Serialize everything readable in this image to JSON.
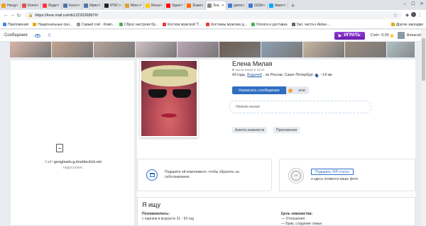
{
  "tabs": [
    {
      "label": "Неодн",
      "color": "#f0a020"
    },
    {
      "label": "Конче",
      "color": "#e05050"
    },
    {
      "label": "Яндекс",
      "color": "#ff3333"
    },
    {
      "label": "Конта",
      "color": "#4a76a8"
    },
    {
      "label": "Ирина",
      "color": "#4a76a8"
    },
    {
      "label": "IPSC ",
      "color": "#222222"
    },
    {
      "label": "Мои ст",
      "color": "#e0a030"
    },
    {
      "label": "Renault",
      "color": "#ffcc00"
    },
    {
      "label": "Удале",
      "color": "#ff0000"
    },
    {
      "label": "Знако",
      "color": "#ff6600"
    },
    {
      "label": "Зна",
      "color": "#888888",
      "active": true
    },
    {
      "label": "gismet",
      "color": "#3a7bd5"
    },
    {
      "label": "GISME",
      "color": "#3a7bd5"
    },
    {
      "label": "Авито",
      "color": "#00aaff"
    }
  ],
  "address": {
    "url": "https://love.mail.ru/mb1222026897#/"
  },
  "bookmarks": [
    {
      "label": "Приложения",
      "color": "#4285f4"
    },
    {
      "label": "Национальные син...",
      "color": "#e6a817"
    },
    {
      "label": "Самый сок! - Комп...",
      "color": "#999999"
    },
    {
      "label": "Сброс настроек бр...",
      "color": "#4caf50"
    },
    {
      "label": "Костюм мужской \"Г...",
      "color": "#e53935"
    },
    {
      "label": "Костюмы мужские д...",
      "color": "#e53935"
    },
    {
      "label": "Оплата и доставка",
      "color": "#4caf50"
    },
    {
      "label": "Зап. части к Akkar-...",
      "color": "#666666"
    }
  ],
  "bookmarks_other": "Другие закладки",
  "header": {
    "messages": "Сообщения",
    "play": "ИГРАТЬ",
    "score": "Счёт: 0.00",
    "user": "Алексей"
  },
  "photostrip_colors": [
    "#d9b5a8",
    "#c4a48f",
    "#b7a29a",
    "#d0c0c4",
    "#bca6b8",
    "#6f5e54",
    "#8ea0b2",
    "#c8b6a0",
    "#9b8c7d",
    "#b2c1c8"
  ],
  "profile": {
    "name": "Елена Милая",
    "online": "Была вчера в 19:31",
    "meta_age": "43 года,",
    "meta_zodiac": "Водолей",
    "meta_from": ", из России, Санкт-Петербург",
    "meta_dist": "~14 км",
    "message_btn": "Написать сообщение",
    "or": "или",
    "status": "Нежная милая",
    "tag1": "Анкета знакомств",
    "tag2": "Приложения"
  },
  "promo": {
    "gift_text": "Подарите ей комплимент, чтобы обратить на себя внимание",
    "vip_badge": "VIP",
    "vip_btn": "Подарить VIP-статус",
    "vip_text": "и здесь появится ваше фото"
  },
  "seeking": {
    "title": "Я ищу",
    "k1": "Познакомлюсь:",
    "v1": "с парнем в возрасте 31 - 50 год",
    "k2": "Цель знакомства:",
    "v2a": "— Отношения",
    "v2b": "— Брак, создание семьи"
  },
  "ad": {
    "text1": "Сайт",
    "host": "googleads.g.doubleclick.net",
    "text2": "недоступен."
  }
}
